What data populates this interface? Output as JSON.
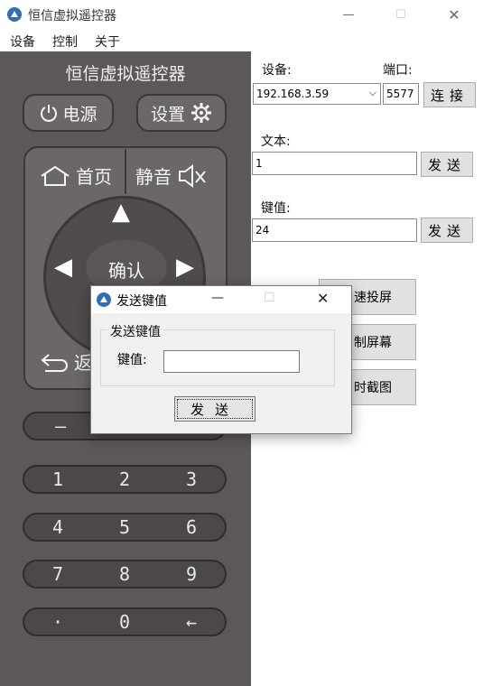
{
  "window": {
    "title": "恒信虚拟遥控器",
    "minimize": "—",
    "maximize": "☐",
    "close": "✕"
  },
  "menu": [
    "设备",
    "控制",
    "关于"
  ],
  "remote": {
    "title": "恒信虚拟遥控器",
    "power_label": "电源",
    "settings_label": "设置",
    "home_label": "首页",
    "mute_label": "静音",
    "ok_label": "确认",
    "back_label": "返",
    "minus_label": "—",
    "keys": [
      [
        "1",
        "2",
        "3"
      ],
      [
        "4",
        "5",
        "6"
      ],
      [
        "7",
        "8",
        "9"
      ],
      [
        "·",
        "0",
        "←"
      ]
    ]
  },
  "form": {
    "device_label": "设备:",
    "device_value": "192.168.3.59",
    "port_label": "端口:",
    "port_value": "5577",
    "connect_button": "连接",
    "text_label": "文本:",
    "text_value": "1",
    "send_text_button": "发送",
    "key_label": "键值:",
    "key_value": "24",
    "send_key_button": "发送",
    "mirror_button": "速投屏",
    "control_button": "制屏幕",
    "screenshot_button": "时截图"
  },
  "dialog": {
    "title": "发送键值",
    "minimize": "—",
    "maximize": "☐",
    "close": "✕",
    "group_title": "发送键值",
    "key_label": "键值:",
    "key_value": "",
    "send_button": "发送"
  }
}
